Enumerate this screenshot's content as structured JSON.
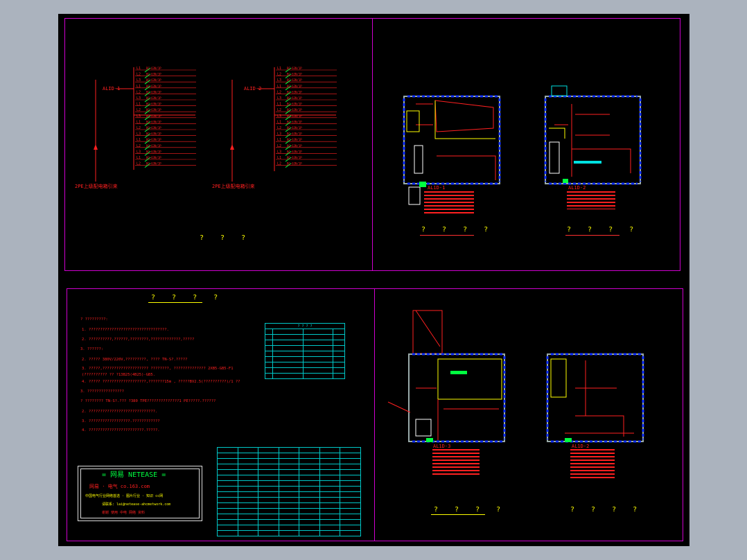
{
  "sheets": {
    "riser_title": "? ? ?",
    "plan1_title": "? ? ? ?",
    "plan2_title": "? ? ? ?",
    "notes_title": "? ? ? ?",
    "plan3_title": "? ? ? ?",
    "plan4_title": "? ? ? ?"
  },
  "riser": {
    "panel_a": "ALID-1",
    "panel_b": "ALID-2",
    "incoming_a": "2PE上级配电箱引来",
    "incoming_b": "2PE上级配电箱引来",
    "breaker": "BC-63N/1P",
    "circuits": [
      "L1",
      "L2",
      "L3",
      "L1",
      "L2",
      "L3",
      "L1",
      "L2",
      "L3",
      "L1",
      "L2",
      "L3",
      "L1",
      "L2",
      "L3",
      "L1",
      "L2"
    ]
  },
  "plans": {
    "p1_label": "AL1D-1",
    "p2_label": "AL1D-2",
    "p3_label": "AL1D-3",
    "p4_label": "AL1D-2"
  },
  "notes": {
    "lines": [
      "? ?????????:",
      "1. ??????????????????????????????????.",
      "2. ??????????,??????,????????,?????????????,?????",
      "3. ??????:",
      "2. ?????  380V/220V,?????????,  ????  TN-S?.?????",
      "3. ?????,????????????????????     ????????,  ??????????????   2XB5-GB5-F1",
      "   (??????????  ??    ?13B25(4B25)-GB5.",
      "4. ?????  ???????????????????,???????15m   ,   ?????BV2.5(??????????)/1 ??",
      "3. ????????????????",
      "? ????????   TN-S?.???  ?380   TPE??????????????1      PE?????.??????",
      "2. ?????????????????????????????.",
      "3. ??????????????????.????????????",
      "4. ????????????????????????.?????."
    ],
    "small_table_title": "? ? ? ?",
    "legend_rows": 16
  },
  "logo": {
    "title": "= 网易  NETEASE =",
    "subtitle": "网易 · 电气    co.163.com",
    "line1": "中国电气行业网络首选 · 图片行业 · 知识 cc网",
    "line2": "请联系: lai@netease-ahcmetwork.com",
    "line3": "谢谢 使用 中电 网络 资料"
  },
  "colors": {
    "frame": "#d000d0",
    "text": "#ffff00",
    "line": "#ff2020",
    "table": "#00c8c8",
    "wall": "#1030ff"
  }
}
